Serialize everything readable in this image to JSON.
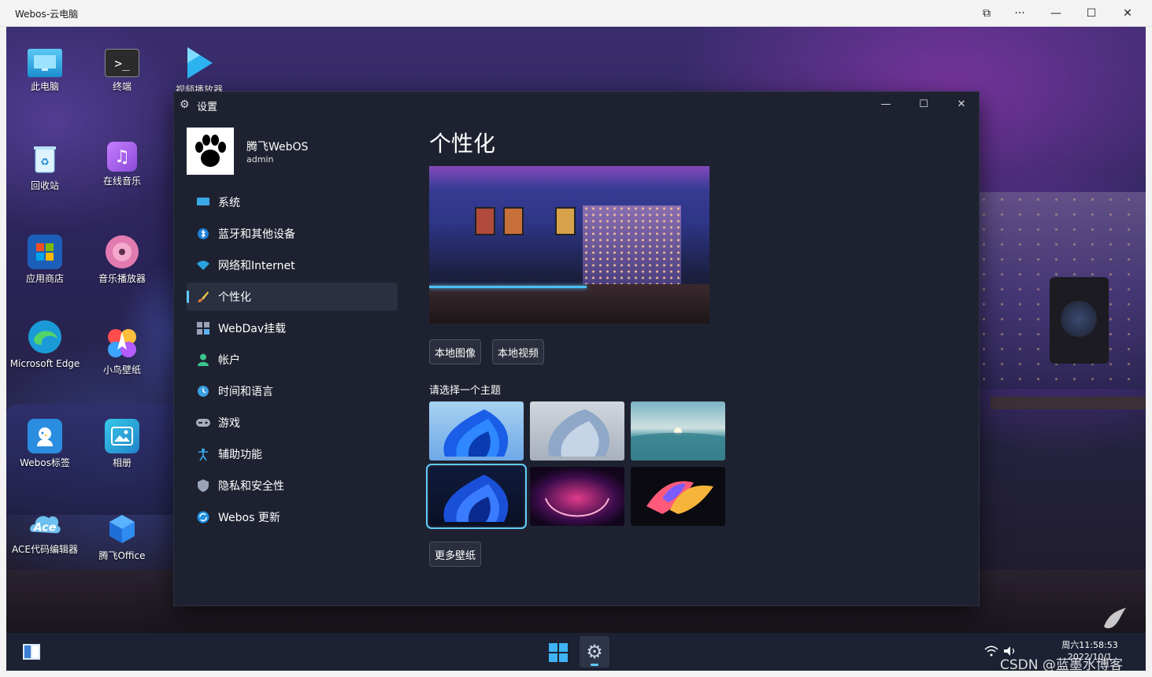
{
  "outer_window": {
    "title": "Webos-云电脑",
    "controls": {
      "cast": "⧉",
      "more": "···",
      "minimize": "—",
      "maximize": "☐",
      "close": "✕"
    }
  },
  "desktop_icons": [
    {
      "label": "此电脑",
      "icon": "monitor-icon"
    },
    {
      "label": "终端",
      "icon": "terminal-icon"
    },
    {
      "label": "视频播放器",
      "icon": "video-player-icon"
    },
    {
      "label": "回收站",
      "icon": "recycle-bin-icon"
    },
    {
      "label": "在线音乐",
      "icon": "music-icon"
    },
    {
      "label": "应用商店",
      "icon": "store-icon"
    },
    {
      "label": "音乐播放器",
      "icon": "disc-icon"
    },
    {
      "label": "Microsoft Edge",
      "icon": "edge-icon"
    },
    {
      "label": "小鸟壁纸",
      "icon": "bird-wallpaper-icon"
    },
    {
      "label": "Webos标签",
      "icon": "chick-icon"
    },
    {
      "label": "相册",
      "icon": "photo-icon"
    },
    {
      "label": "ACE代码编辑器",
      "icon": "ace-icon"
    },
    {
      "label": "腾飞Office",
      "icon": "office-cube-icon"
    }
  ],
  "settings": {
    "title": "设置",
    "controls": {
      "minimize": "—",
      "maximize": "☐",
      "close": "✕"
    },
    "profile": {
      "name": "腾飞WebOS",
      "account": "admin"
    },
    "nav": [
      {
        "label": "系统",
        "icon": "display-icon"
      },
      {
        "label": "蓝牙和其他设备",
        "icon": "bluetooth-icon"
      },
      {
        "label": "网络和Internet",
        "icon": "wifi-icon"
      },
      {
        "label": "个性化",
        "icon": "brush-icon",
        "active": true
      },
      {
        "label": "WebDav挂载",
        "icon": "apps-icon"
      },
      {
        "label": "帐户",
        "icon": "account-icon"
      },
      {
        "label": "时间和语言",
        "icon": "clock-icon"
      },
      {
        "label": "游戏",
        "icon": "gamepad-icon"
      },
      {
        "label": "辅助功能",
        "icon": "accessibility-icon"
      },
      {
        "label": "隐私和安全性",
        "icon": "shield-icon"
      },
      {
        "label": "Webos 更新",
        "icon": "update-icon"
      }
    ],
    "content": {
      "title": "个性化",
      "local_image_button": "本地图像",
      "local_video_button": "本地视频",
      "theme_label": "请选择一个主题",
      "themes": [
        {
          "name": "bloom-blue-light",
          "selected": false
        },
        {
          "name": "bloom-silver",
          "selected": false
        },
        {
          "name": "lake-sunrise",
          "selected": false
        },
        {
          "name": "bloom-blue-dark",
          "selected": true
        },
        {
          "name": "glow-purple",
          "selected": false
        },
        {
          "name": "flow-colorful",
          "selected": false
        }
      ],
      "more_wallpapers_button": "更多壁纸"
    }
  },
  "taskbar": {
    "clock_time": "周六11:58:53",
    "clock_date": "2022/10/1",
    "watermark": "CSDN @蓝墨水博客"
  },
  "colors": {
    "accent": "#60cdff",
    "window_bg": "#1e2230",
    "taskbar_bg": "#1c2233"
  }
}
